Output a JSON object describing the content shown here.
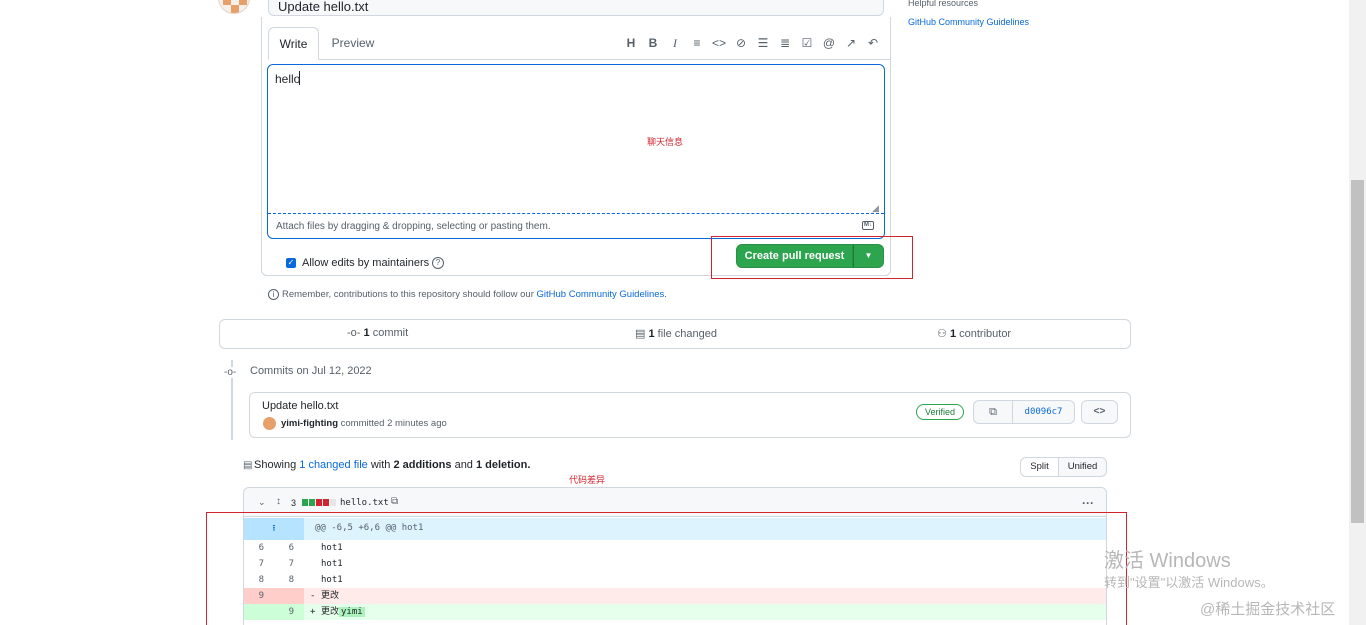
{
  "pr_form": {
    "title_value": "Update hello.txt",
    "tabs": [
      {
        "label": "Write"
      },
      {
        "label": "Preview"
      }
    ],
    "toolbar_icons": [
      "heading-icon",
      "bold-icon",
      "italic-icon",
      "quote-icon",
      "code-icon",
      "link-icon",
      "unordered-list-icon",
      "ordered-list-icon",
      "task-list-icon",
      "mention-icon",
      "reference-icon",
      "undo-icon"
    ],
    "body_value": "hello",
    "attach_text": "Attach files by dragging & dropping, selecting or pasting them.",
    "allow_edits_label": "Allow edits by maintainers",
    "create_button": "Create pull request",
    "remember_prefix": "Remember, contributions to this repository should follow our ",
    "remember_link": "GitHub Community Guidelines",
    "remember_suffix": "."
  },
  "annotations": {
    "chat_info": "聊天信息",
    "code_diff": "代码差异"
  },
  "sidebar": {
    "helpful_resources": "Helpful resources",
    "guidelines_link": "GitHub Community Guidelines"
  },
  "stats": {
    "commits_count": "1",
    "commits_label": "commit",
    "files_count": "1",
    "files_label": "file changed",
    "contributors_count": "1",
    "contributors_label": "contributor"
  },
  "commits": {
    "date_label": "Commits on Jul 12, 2022",
    "title": "Update hello.txt",
    "author": "yimi-fighting",
    "meta": "committed 2 minutes ago",
    "verified": "Verified",
    "sha": "d0096c7"
  },
  "diff_summary": {
    "showing": "Showing ",
    "changed_link": "1 changed file",
    "with": " with ",
    "additions": "2 additions",
    "and": " and ",
    "deletions": "1 deletion.",
    "split_label": "Split",
    "unified_label": "Unified"
  },
  "file": {
    "changes_count": "3",
    "filename": "hello.txt",
    "diffstat_colors": [
      "#2da44e",
      "#2da44e",
      "#d1242f",
      "#d1242f",
      "#e6e6e6"
    ],
    "hunk": "@@ -6,5 +6,6 @@ hot1",
    "lines": [
      {
        "old": "6",
        "new": "6",
        "sign": "",
        "code": "hot1",
        "type": "ctx"
      },
      {
        "old": "7",
        "new": "7",
        "sign": "",
        "code": "hot1",
        "type": "ctx"
      },
      {
        "old": "8",
        "new": "8",
        "sign": "",
        "code": "hot1",
        "type": "ctx"
      },
      {
        "old": "9",
        "new": "",
        "sign": "-",
        "code": "更改",
        "type": "del"
      },
      {
        "old": "",
        "new": "9",
        "sign": "+",
        "code": "更改",
        "code_hl": "yimi",
        "type": "add"
      }
    ]
  },
  "watermark": {
    "line1": "激活 Windows",
    "line2": "转到\"设置\"以激活 Windows。",
    "line3": "@稀土掘金技术社区"
  }
}
